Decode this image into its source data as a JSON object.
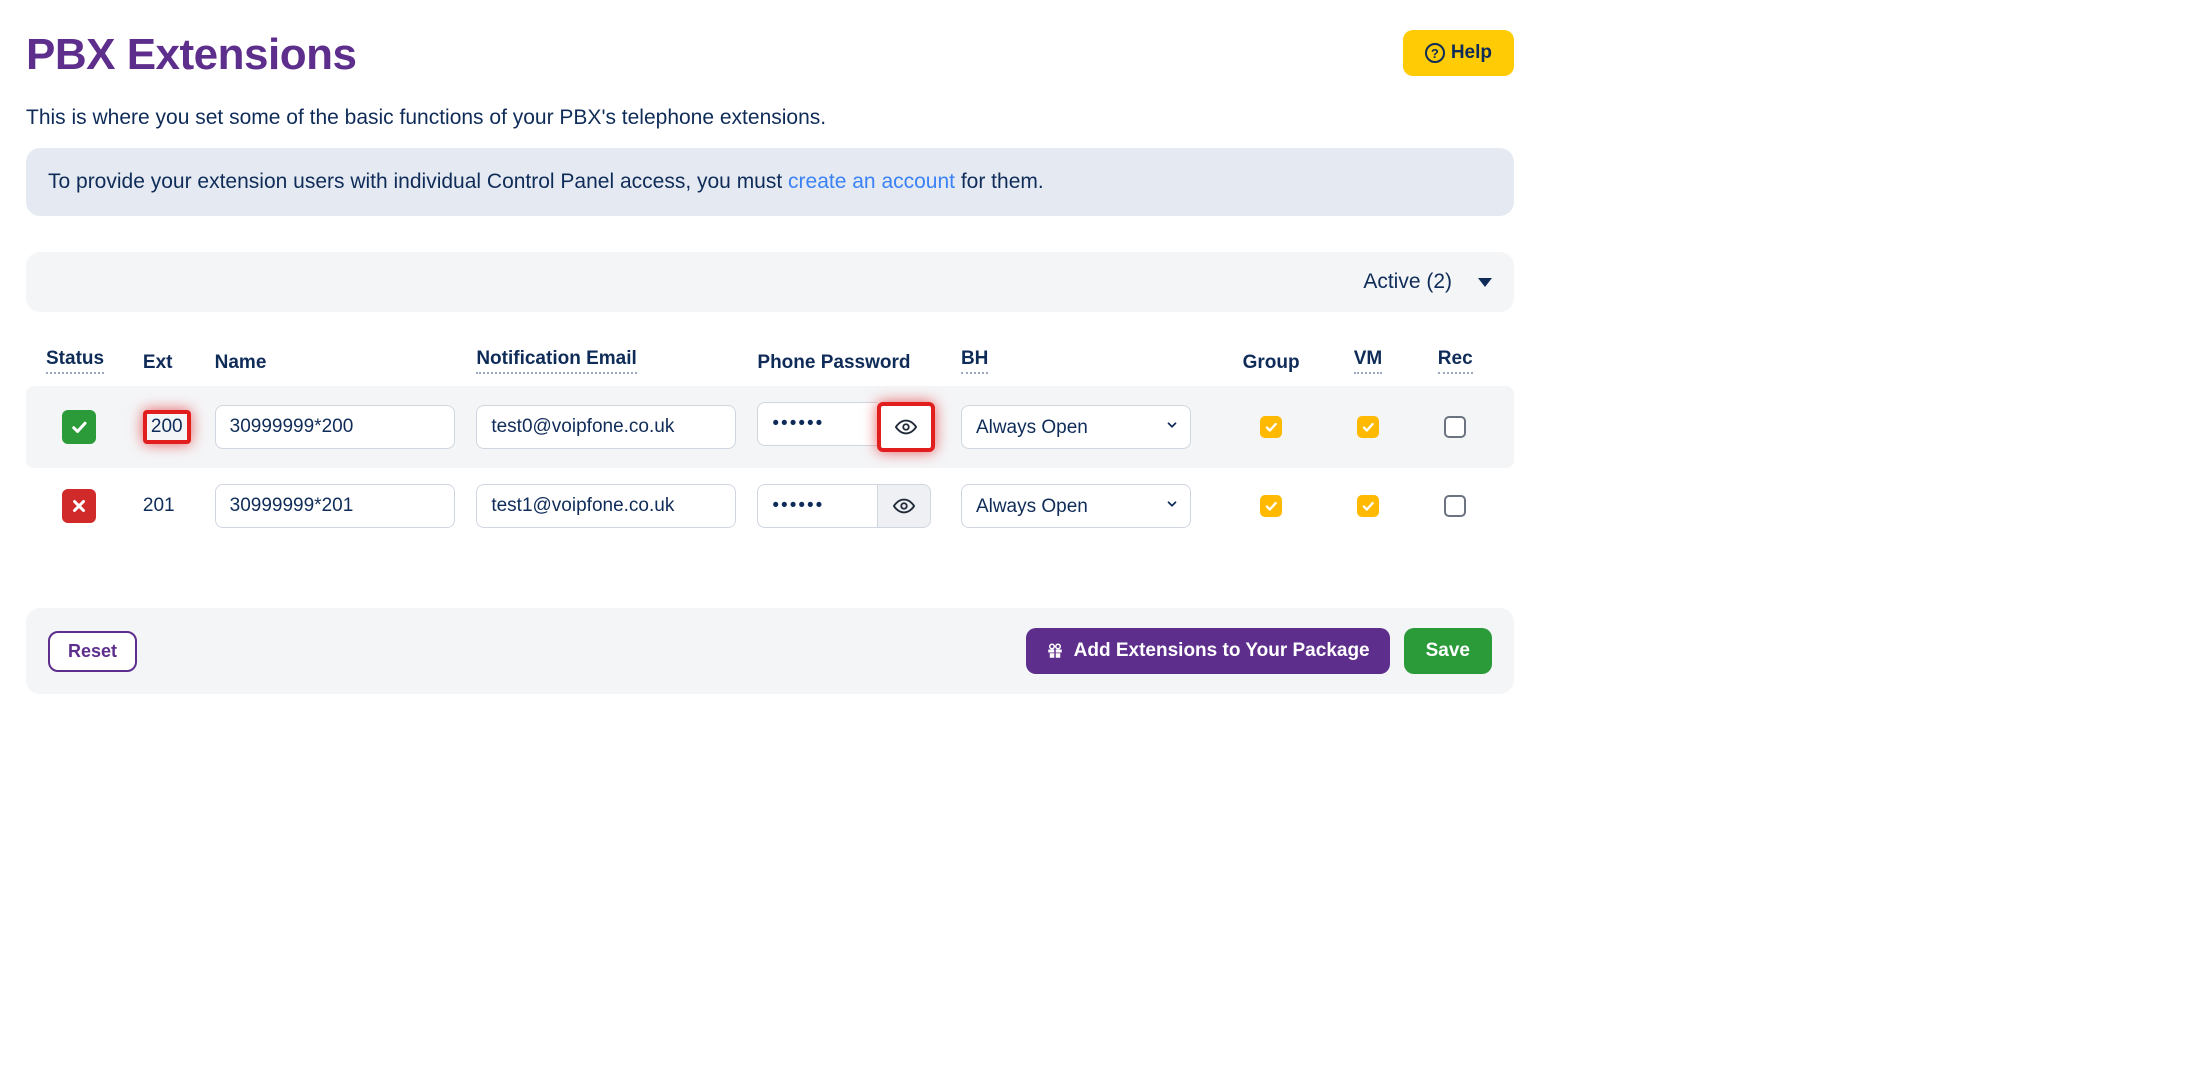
{
  "header": {
    "title": "PBX Extensions",
    "help_label": "Help"
  },
  "subtitle": "This is where you set some of the basic functions of your PBX's telephone extensions.",
  "info_banner": {
    "prefix": "To provide your extension users with individual Control Panel access, you must ",
    "link_text": "create an account",
    "suffix": " for them."
  },
  "filter": {
    "label": "Active (2)"
  },
  "columns": {
    "status": "Status",
    "ext": "Ext",
    "name": "Name",
    "email": "Notification Email",
    "password": "Phone Password",
    "bh": "BH",
    "group": "Group",
    "vm": "VM",
    "rec": "Rec"
  },
  "rows": [
    {
      "status": "ok",
      "ext": "200",
      "ext_highlight": true,
      "name": "30999999*200",
      "email": "test0@voipfone.co.uk",
      "password": "••••••",
      "eye_highlight": true,
      "bh": "Always Open",
      "group": true,
      "vm": true,
      "rec": false
    },
    {
      "status": "error",
      "ext": "201",
      "ext_highlight": false,
      "name": "30999999*201",
      "email": "test1@voipfone.co.uk",
      "password": "••••••",
      "eye_highlight": false,
      "bh": "Always Open",
      "group": true,
      "vm": true,
      "rec": false
    }
  ],
  "footer": {
    "reset": "Reset",
    "add": "Add Extensions to Your Package",
    "save": "Save"
  }
}
